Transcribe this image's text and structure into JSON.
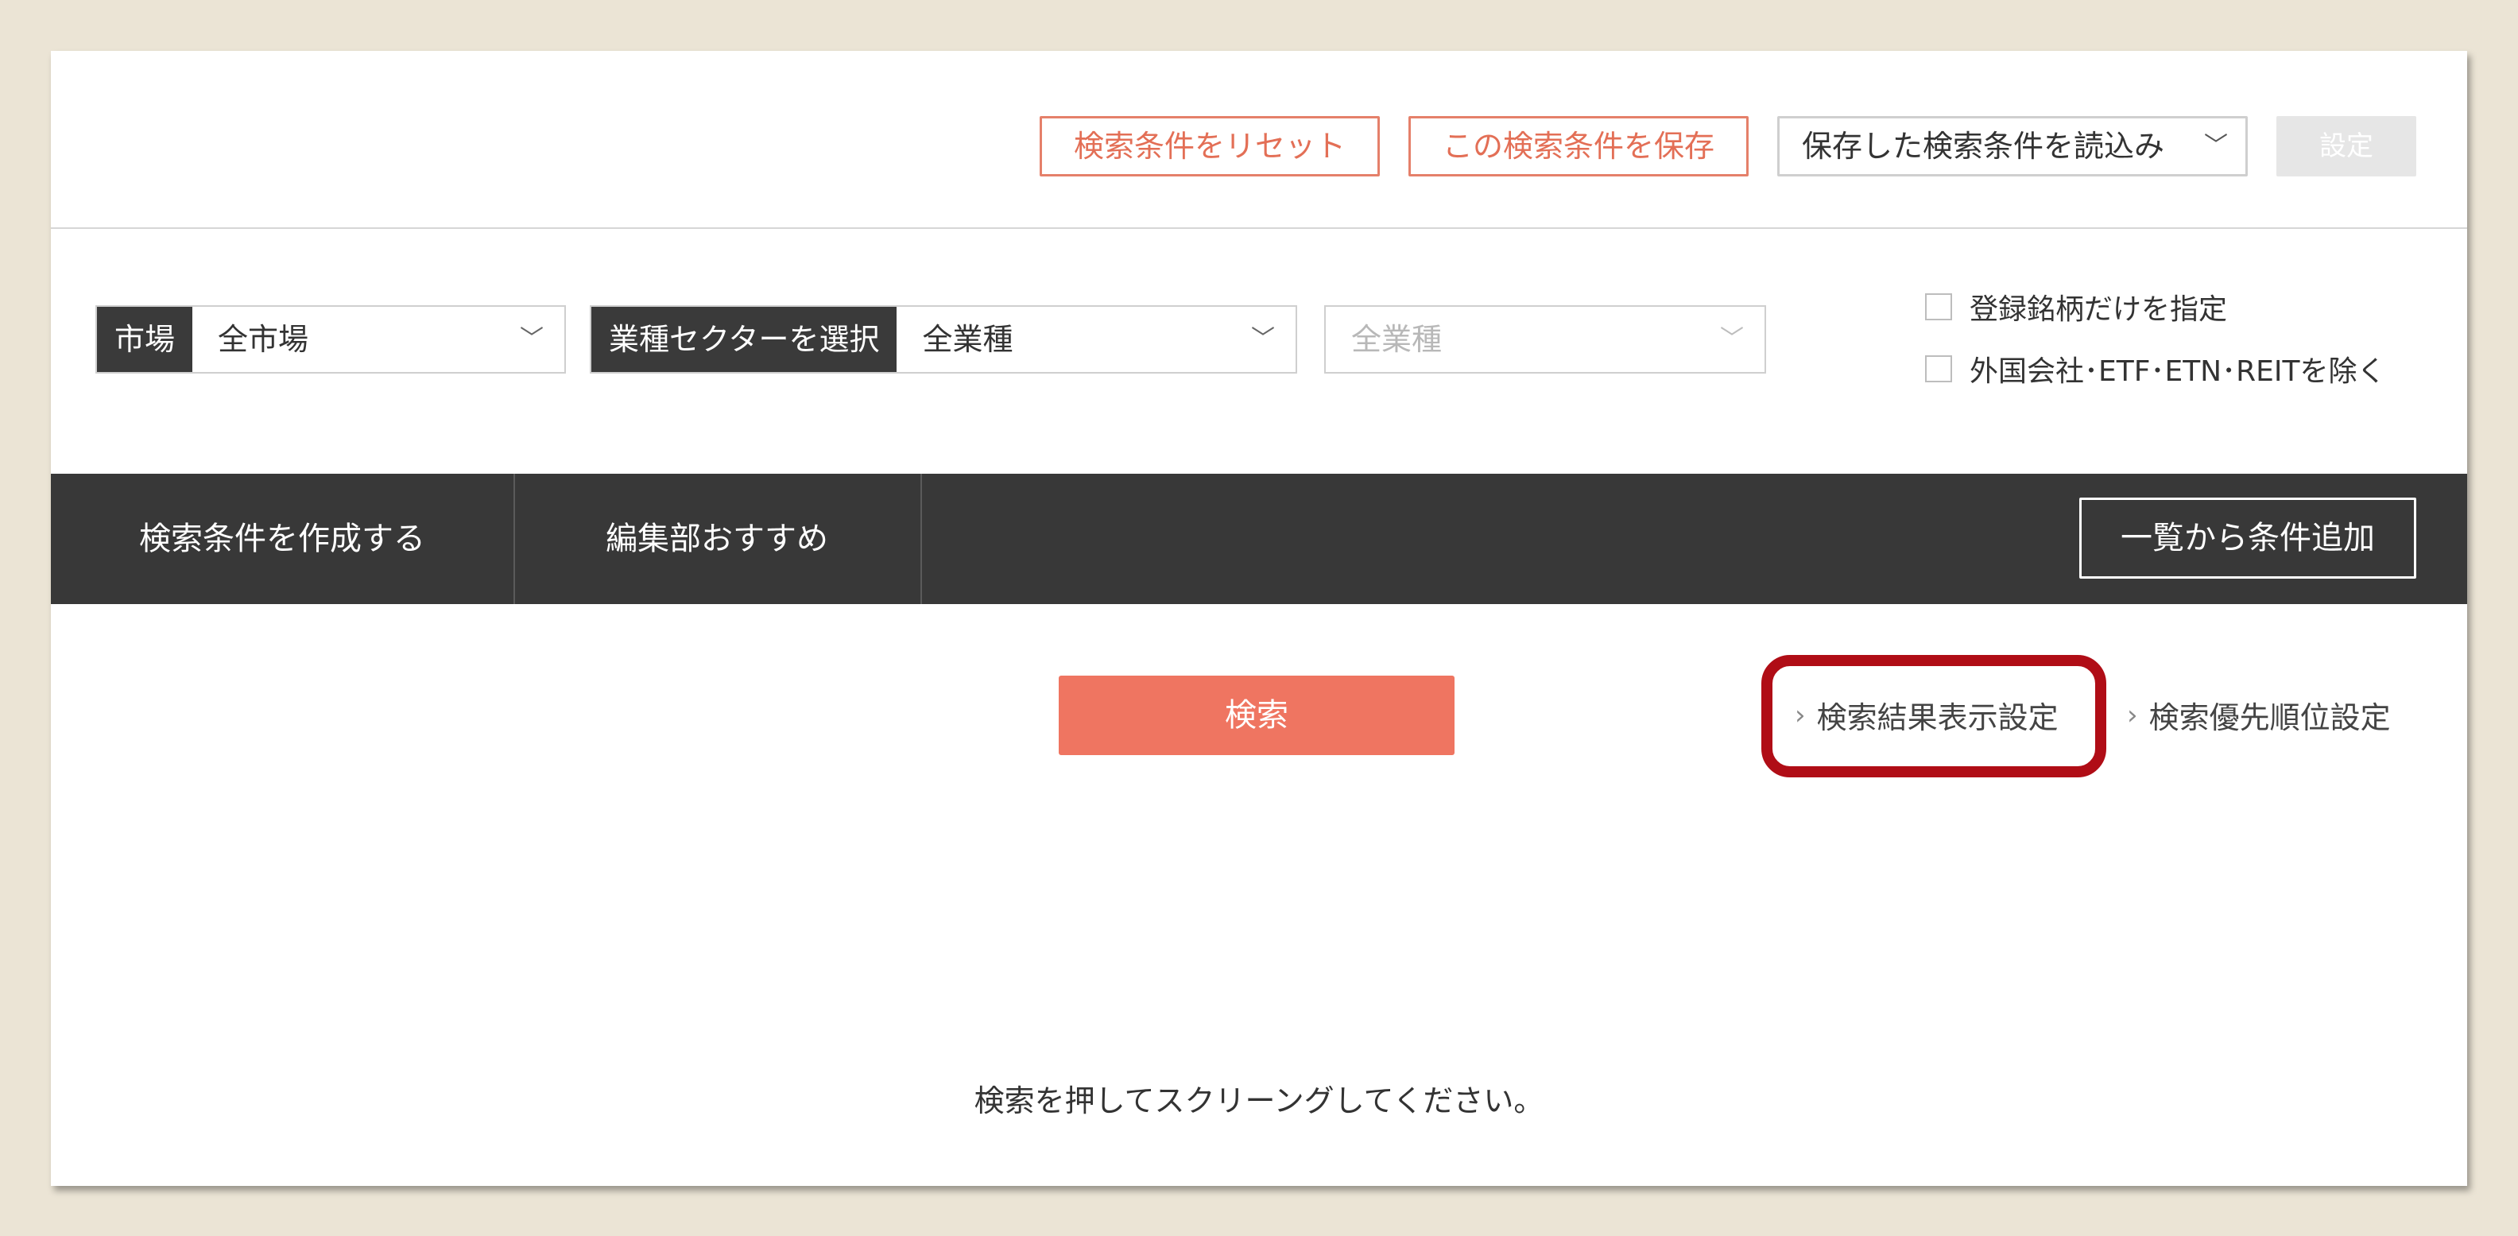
{
  "toolbar": {
    "reset_label": "検索条件をリセット",
    "save_label": "この検索条件を保存",
    "load_label": "保存した検索条件を読込み",
    "settings_label": "設定"
  },
  "filters": {
    "market_tag": "市場",
    "market_value": "全市場",
    "sector_tag": "業種セクターを選択",
    "sector_value": "全業種",
    "sub_value": "全業種",
    "check_registered": "登録銘柄だけを指定",
    "check_exclude": "外国会社･ETF･ETN･REITを除く"
  },
  "tabs": {
    "create": "検索条件を作成する",
    "editor": "編集部おすすめ",
    "add_from_list": "一覧から条件追加"
  },
  "search": {
    "button": "検索",
    "display_settings": "検索結果表示設定",
    "priority_settings": "検索優先順位設定",
    "hint": "検索を押してスクリーングしてください。"
  },
  "icons": {
    "chevron": "chevron-down-icon",
    "arrow": "chevron-right-icon"
  },
  "colors": {
    "accent": "#ef7561",
    "outline_accent": "#e36f56",
    "dark_bar": "#383838",
    "highlight": "#b00d16"
  }
}
